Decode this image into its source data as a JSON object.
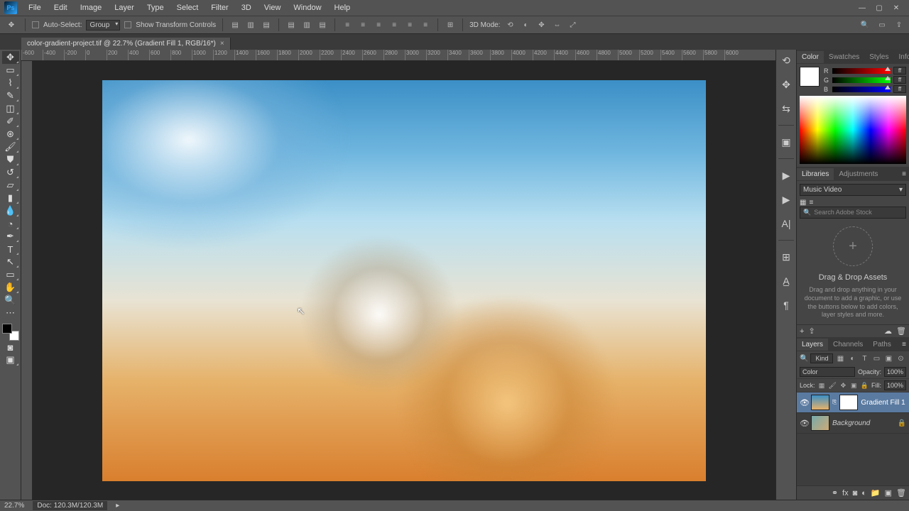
{
  "app": {
    "logo": "Ps"
  },
  "menu": [
    "File",
    "Edit",
    "Image",
    "Layer",
    "Type",
    "Select",
    "Filter",
    "3D",
    "View",
    "Window",
    "Help"
  ],
  "options": {
    "auto_select_label": "Auto-Select:",
    "auto_select_value": "Group",
    "show_transform": "Show Transform Controls",
    "mode_label": "3D Mode:"
  },
  "tab": {
    "title": "color-gradient-project.tif @ 22.7% (Gradient Fill 1, RGB/16*)",
    "close": "×"
  },
  "ruler_ticks": [
    "-600",
    "-400",
    "-200",
    "0",
    "200",
    "400",
    "600",
    "800",
    "1000",
    "1200",
    "1400",
    "1600",
    "1800",
    "2000",
    "2200",
    "2400",
    "2600",
    "2800",
    "3000",
    "3200",
    "3400",
    "3600",
    "3800",
    "4000",
    "4200",
    "4400",
    "4600",
    "4800",
    "5000",
    "5200",
    "5400",
    "5600",
    "5800",
    "6000"
  ],
  "panels": {
    "color": {
      "tabs": [
        "Color",
        "Swatches",
        "Styles",
        "Info"
      ],
      "channels": [
        "R",
        "G",
        "B"
      ],
      "val": "ff"
    },
    "libraries": {
      "tabs": [
        "Libraries",
        "Adjustments"
      ],
      "dropdown": "Music Video",
      "search_placeholder": "Search Adobe Stock",
      "title": "Drag & Drop Assets",
      "desc": "Drag and drop anything in your document to add a graphic, or use the buttons below to add colors, layer styles and more."
    },
    "layers": {
      "tabs": [
        "Layers",
        "Channels",
        "Paths"
      ],
      "filter_label": "Kind",
      "blend_mode": "Color",
      "opacity_label": "Opacity:",
      "opacity_val": "100%",
      "lock_label": "Lock:",
      "fill_label": "Fill:",
      "fill_val": "100%",
      "items": [
        {
          "name": "Gradient Fill 1",
          "selected": true,
          "type": "gradient"
        },
        {
          "name": "Background",
          "selected": false,
          "type": "image",
          "locked": true
        }
      ]
    }
  },
  "status": {
    "zoom": "22.7%",
    "doc": "Doc: 120.3M/120.3M"
  }
}
